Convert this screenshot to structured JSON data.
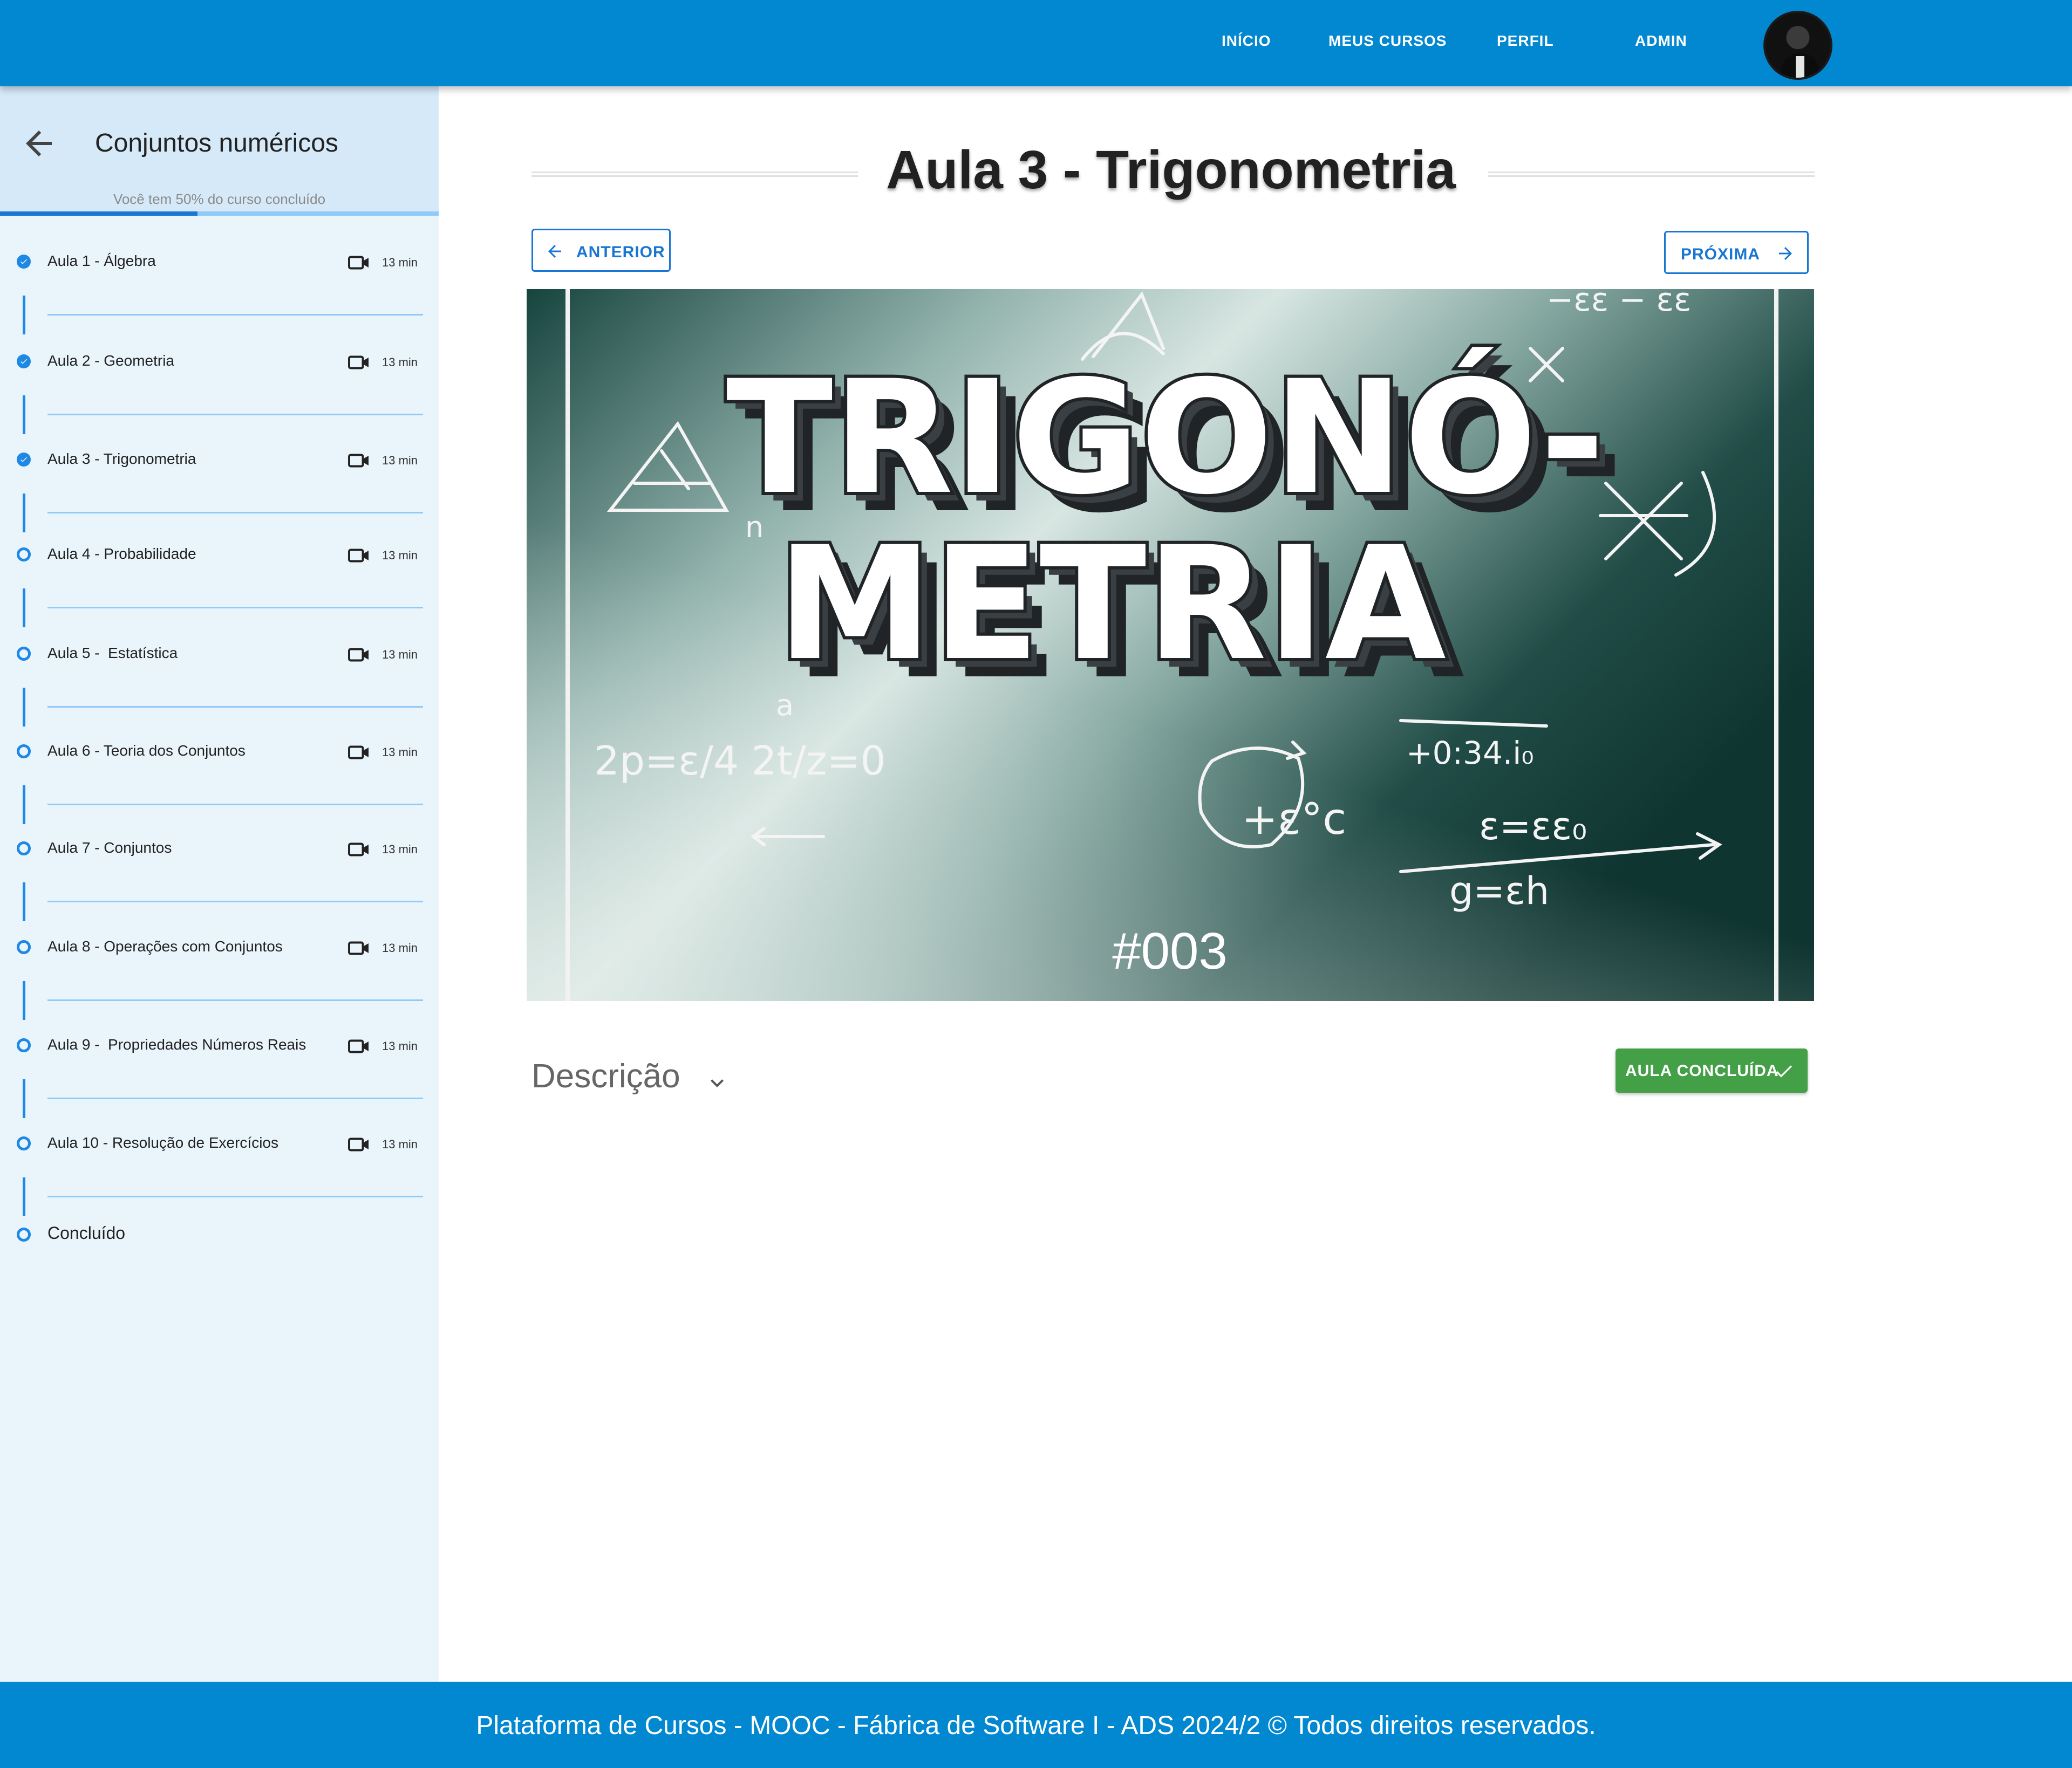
{
  "nav": {
    "links": [
      "INÍCIO",
      "MEUS CURSOS",
      "PERFIL",
      "ADMIN"
    ]
  },
  "sidebar": {
    "course_title": "Conjuntos numéricos",
    "progress_text": "Você tem 50% do curso concluído",
    "progress_fraction": 0.45,
    "lessons": [
      {
        "label": "Aula 1 - Álgebra",
        "duration": "13 min",
        "completed": true
      },
      {
        "label": "Aula 2 - Geometria",
        "duration": "13 min",
        "completed": true
      },
      {
        "label": "Aula 3 - Trigonometria",
        "duration": "13 min",
        "completed": true
      },
      {
        "label": "Aula 4 - Probabilidade",
        "duration": "13 min",
        "completed": false
      },
      {
        "label": "Aula 5 -  Estatística",
        "duration": "13 min",
        "completed": false
      },
      {
        "label": "Aula 6 - Teoria dos Conjuntos",
        "duration": "13 min",
        "completed": false
      },
      {
        "label": "Aula 7 - Conjuntos",
        "duration": "13 min",
        "completed": false
      },
      {
        "label": "Aula 8 - Operações com Conjuntos",
        "duration": "13 min",
        "completed": false
      },
      {
        "label": "Aula 9 -  Propriedades Números Reais",
        "duration": "13 min",
        "completed": false
      },
      {
        "label": "Aula 10 - Resolução de Exercícios",
        "duration": "13 min",
        "completed": false
      }
    ],
    "final_label": "Concluído"
  },
  "main": {
    "lesson_title": "Aula 3 - Trigonometria",
    "prev_label": "ANTERIOR",
    "next_label": "PRÓXIMA",
    "banner": {
      "title_line1": "TRIGONÓ-",
      "title_line2": "METRIA",
      "number": "#003"
    },
    "description_label": "Descrição",
    "completed_button": "AULA CONCLUÍDA"
  },
  "footer": {
    "text": "Plataforma de Cursos - MOOC - Fábrica de Software I - ADS 2024/2  ©  Todos direitos reservados."
  },
  "colors": {
    "primary": "#0288d1",
    "accent": "#1976d2",
    "success": "#43a047",
    "sidebar_bg": "#e9f4fb"
  }
}
